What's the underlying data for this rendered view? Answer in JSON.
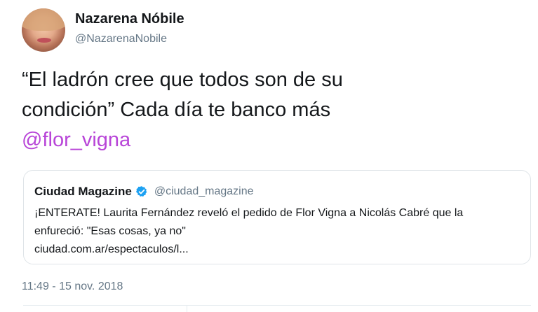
{
  "author": {
    "name": "Nazarena Nóbile",
    "handle": "@NazarenaNobile"
  },
  "tweet": {
    "text_line1": "“El ladrón cree que todos son de su",
    "text_line2": "condición” Cada día te banco más",
    "mention": "@flor_vigna"
  },
  "quoted": {
    "name": "Ciudad Magazine",
    "handle": "@ciudad_magazine",
    "verified": true,
    "text_line1": "¡ENTERATE! Laurita Fernández reveló el pedido de Flor Vigna a Nicolás Cabré que la",
    "text_line2": "enfureció: \"Esas cosas, ya no\"",
    "link": "ciudad.com.ar/espectaculos/l..."
  },
  "timestamp": "11:49 - 15 nov. 2018",
  "colors": {
    "mention": "#b845d8",
    "secondary_text": "#657786",
    "verified": "#1da1f2",
    "border": "#dfe4e8"
  }
}
